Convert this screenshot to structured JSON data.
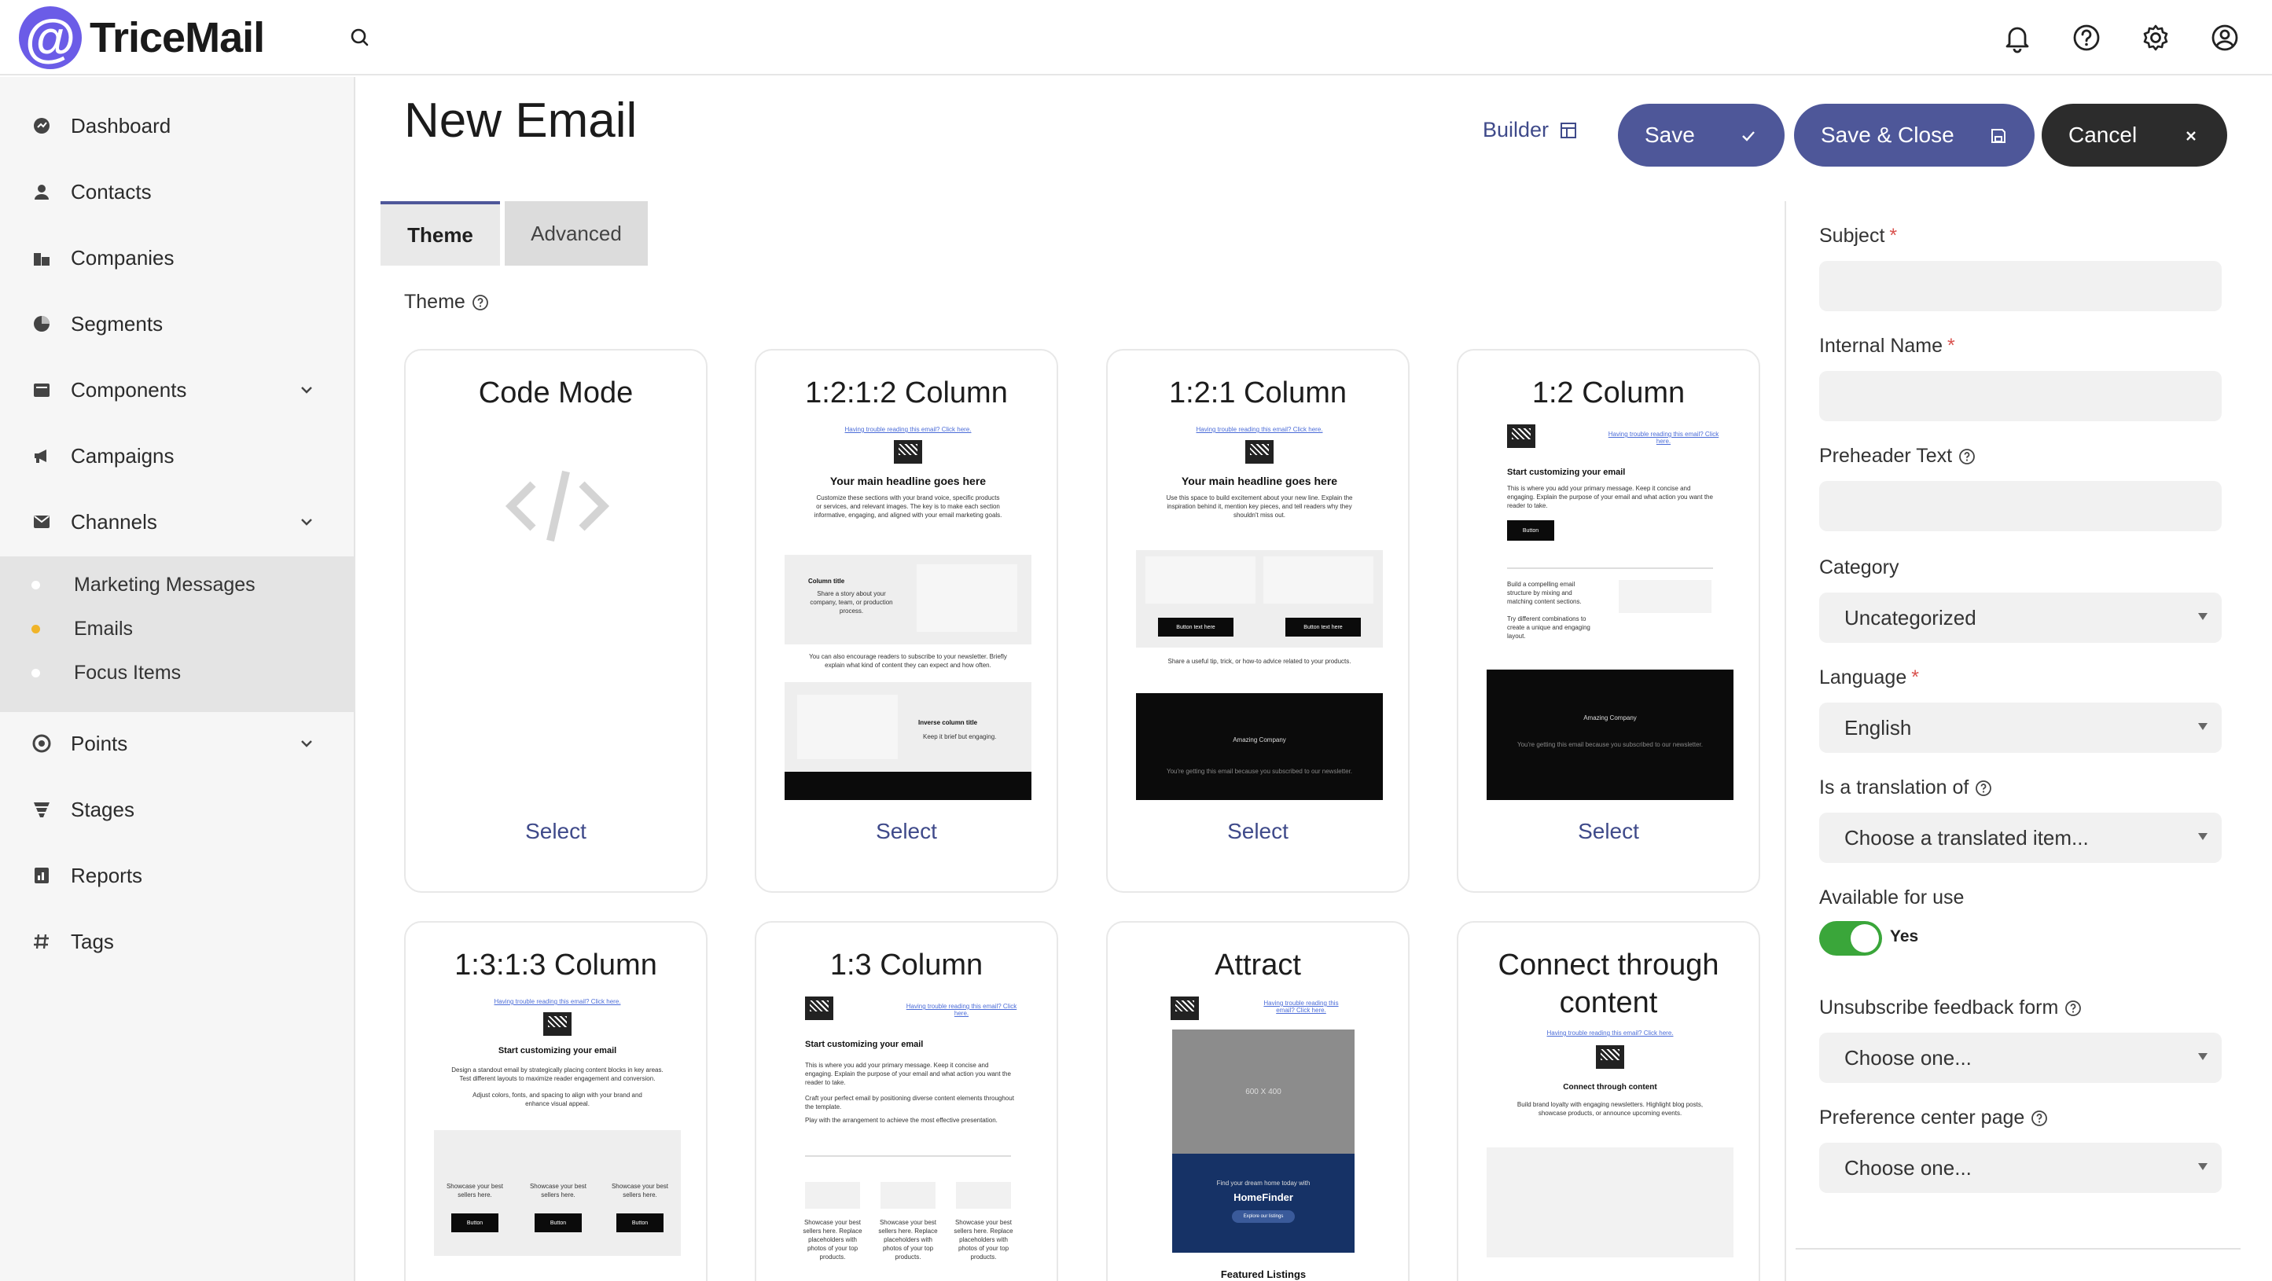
{
  "app": {
    "logo_symbol": "@",
    "logo_text": "TriceMail",
    "accent_color": "#4e5799",
    "logo_color": "#6b5ce7"
  },
  "topbar": {
    "icons": [
      "search-icon",
      "bell-icon",
      "help-icon",
      "gear-icon",
      "user-icon"
    ]
  },
  "sidebar": {
    "items": [
      {
        "label": "Dashboard",
        "icon": "dashboard-icon"
      },
      {
        "label": "Contacts",
        "icon": "contacts-icon"
      },
      {
        "label": "Companies",
        "icon": "companies-icon"
      },
      {
        "label": "Segments",
        "icon": "segments-icon"
      },
      {
        "label": "Components",
        "icon": "components-icon"
      },
      {
        "label": "Campaigns",
        "icon": "campaigns-icon"
      },
      {
        "label": "Channels",
        "icon": "channels-icon"
      },
      {
        "label": "Points",
        "icon": "points-icon"
      },
      {
        "label": "Stages",
        "icon": "stages-icon"
      },
      {
        "label": "Reports",
        "icon": "reports-icon"
      },
      {
        "label": "Tags",
        "icon": "tags-icon"
      }
    ],
    "channels_sub": [
      {
        "label": "Marketing Messages",
        "active": false
      },
      {
        "label": "Emails",
        "active": true
      },
      {
        "label": "Focus Items",
        "active": false
      }
    ]
  },
  "header": {
    "title": "New Email",
    "builder_label": "Builder",
    "save_label": "Save",
    "save_close_label": "Save & Close",
    "cancel_label": "Cancel"
  },
  "tabs": [
    {
      "label": "Theme",
      "active": true
    },
    {
      "label": "Advanced",
      "active": false
    }
  ],
  "theme_section_label": "Theme",
  "select_label": "Select",
  "themes": [
    {
      "title": "Code Mode",
      "link": "",
      "headline": "",
      "body": "",
      "col_title": "",
      "col_body": "",
      "col_body2": "",
      "inv_title": "",
      "inv_body": "",
      "btn": "",
      "share": "",
      "company": "",
      "footer": "",
      "img_label": "",
      "brand_line": "",
      "brand_name": "",
      "brand_btn": "",
      "listings": ""
    },
    {
      "title": "1:2:1:2 Column",
      "link": "Having trouble reading this email? Click here.",
      "headline": "Your main headline goes here",
      "body": "Customize these sections with your brand voice, specific products or services, and relevant images. The key is to make each section informative, engaging, and aligned with your email marketing goals.",
      "col_title": "Column title",
      "col_body": "Share a story about your company, team, or production process.",
      "col_body2": "You can also encourage readers to subscribe to your newsletter. Briefly explain what kind of content they can expect and how often.",
      "inv_title": "Inverse column title",
      "inv_body": "Keep it brief but engaging.",
      "btn": "",
      "share": "",
      "company": "",
      "footer": "",
      "img_label": "",
      "brand_line": "",
      "brand_name": "",
      "brand_btn": "",
      "listings": ""
    },
    {
      "title": "1:2:1 Column",
      "link": "Having trouble reading this email? Click here.",
      "headline": "Your main headline goes here",
      "body": "Use this space to build excitement about your new line. Explain the inspiration behind it, mention key pieces, and tell readers why they shouldn't miss out.",
      "col_title": "",
      "col_body": "",
      "col_body2": "",
      "inv_title": "",
      "inv_body": "",
      "btn": "Button text here",
      "share": "Share a useful tip, trick, or how-to advice related to your products.",
      "company": "Amazing Company",
      "footer": "You're getting this email because you subscribed to our newsletter.",
      "img_label": "",
      "brand_line": "",
      "brand_name": "",
      "brand_btn": "",
      "listings": ""
    },
    {
      "title": "1:2 Column",
      "link": "Having trouble reading this email? Click here.",
      "headline": "Start customizing your email",
      "body": "This is where you add your primary message. Keep it concise and engaging. Explain the purpose of your email and what action you want the reader to take.",
      "col_title": "",
      "col_body": "Build a compelling email structure by mixing and matching content sections.",
      "col_body2": "Try different combinations to create a unique and engaging layout.",
      "inv_title": "",
      "inv_body": "",
      "btn": "Button",
      "share": "",
      "company": "Amazing Company",
      "footer": "You're getting this email because you subscribed to our newsletter.",
      "img_label": "",
      "brand_line": "",
      "brand_name": "",
      "brand_btn": "",
      "listings": ""
    },
    {
      "title": "1:3:1:3 Column",
      "link": "Having trouble reading this email? Click here.",
      "headline": "Start customizing your email",
      "body": "Design a standout email by strategically placing content blocks in key areas. Test different layouts to maximize reader engagement and conversion.",
      "col_title": "",
      "col_body": "Adjust colors, fonts, and spacing to align with your brand and enhance visual appeal.",
      "col_body2": "Showcase your best sellers here.",
      "inv_title": "",
      "inv_body": "",
      "btn": "Button",
      "share": "",
      "company": "",
      "footer": "",
      "img_label": "",
      "brand_line": "",
      "brand_name": "",
      "brand_btn": "",
      "listings": ""
    },
    {
      "title": "1:3 Column",
      "link": "Having trouble reading this email? Click here.",
      "headline": "Start customizing your email",
      "body": "This is where you add your primary message. Keep it concise and engaging. Explain the purpose of your email and what action you want the reader to take.",
      "col_title": "",
      "col_body": "Craft your perfect email by positioning diverse content elements throughout the template.",
      "col_body2": "Play with the arrangement to achieve the most effective presentation.",
      "inv_title": "",
      "inv_body": "",
      "btn": "",
      "share": "Showcase your best sellers here. Replace placeholders with photos of your top products.",
      "company": "",
      "footer": "",
      "img_label": "",
      "brand_line": "",
      "brand_name": "",
      "brand_btn": "",
      "listings": ""
    },
    {
      "title": "Attract",
      "link": "Having trouble reading this email? Click here.",
      "headline": "",
      "body": "",
      "col_title": "",
      "col_body": "",
      "col_body2": "",
      "inv_title": "",
      "inv_body": "",
      "btn": "",
      "share": "",
      "company": "",
      "footer": "",
      "img_label": "600 X 400",
      "brand_line": "Find your dream home today with",
      "brand_name": "HomeFinder",
      "brand_btn": "Explore our listings",
      "listings": "Featured Listings"
    },
    {
      "title": "Connect through content",
      "link": "Having trouble reading this email? Click here.",
      "headline": "Connect through content",
      "body": "Build brand loyalty with engaging newsletters. Highlight blog posts, showcase products, or announce upcoming events.",
      "col_title": "",
      "col_body": "",
      "col_body2": "",
      "inv_title": "",
      "inv_body": "",
      "btn": "",
      "share": "",
      "company": "",
      "footer": "",
      "img_label": "",
      "brand_line": "",
      "brand_name": "",
      "brand_btn": "",
      "listings": ""
    }
  ],
  "form": {
    "subject_label": "Subject",
    "subject_value": "",
    "internal_name_label": "Internal Name",
    "internal_name_value": "",
    "preheader_label": "Preheader Text",
    "preheader_value": "",
    "category_label": "Category",
    "category_value": "Uncategorized",
    "language_label": "Language",
    "language_value": "English",
    "translation_label": "Is a translation of",
    "translation_value": "Choose a translated item...",
    "available_label": "Available for use",
    "available_value": "Yes",
    "available_on": true,
    "unsubscribe_label": "Unsubscribe feedback form",
    "unsubscribe_value": "Choose one...",
    "preference_label": "Preference center page",
    "preference_value": "Choose one...",
    "required_mark": "*"
  }
}
